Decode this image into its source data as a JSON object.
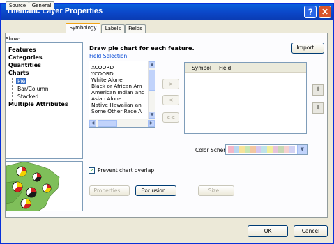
{
  "window": {
    "title": "Thematic Layer Properties",
    "help_glyph": "?",
    "close_glyph": "✕"
  },
  "tabs": [
    {
      "label": "Source"
    },
    {
      "label": "General"
    },
    {
      "label": "Symbology"
    },
    {
      "label": "Labels"
    },
    {
      "label": "Fields"
    }
  ],
  "left_panel": {
    "show_label": "Show:",
    "tree": [
      {
        "label": "Features"
      },
      {
        "label": "Categories"
      },
      {
        "label": "Quantities"
      },
      {
        "label": "Charts"
      },
      {
        "label": "Pie"
      },
      {
        "label": "Bar/Column"
      },
      {
        "label": "Stacked"
      },
      {
        "label": "Multiple Attributes"
      }
    ]
  },
  "main": {
    "heading": "Draw pie chart for each feature.",
    "import_label": "Import...",
    "field_selection_label": "Field Selection",
    "fields": [
      "XCOORD",
      "YCOORD",
      "White Alone",
      "Black or African Am",
      "American Indian anc",
      "Asian Alone",
      "Native Hawaiian an",
      "Some Other Race A"
    ],
    "move_buttons": {
      "add": ">",
      "remove": "<",
      "remove_all": "<<"
    },
    "symbol_columns": {
      "symbol": "Symbol",
      "field": "Field"
    },
    "color_scheme_label": "Color Scheme:",
    "color_scheme_swatches": [
      "#f4b6c8",
      "#b9d7f2",
      "#f7e39a",
      "#c9e7b4",
      "#f3c7a1",
      "#d7c6ef",
      "#bfe3e9",
      "#f2f09c",
      "#e7c2db",
      "#c8d8b4",
      "#f6d0d0",
      "#d2d2f4"
    ],
    "prevent_overlap_label": "Prevent chart overlap",
    "properties_label": "Properties...",
    "exclusion_label": "Exclusion...",
    "size_label": "Size..."
  },
  "footer": {
    "ok_label": "OK",
    "cancel_label": "Cancel"
  },
  "colors": {
    "title_bar": "#0b47c8",
    "selection": "#316ac5",
    "dialog_bg": "#ece9d8",
    "link_blue": "#0046d5"
  }
}
